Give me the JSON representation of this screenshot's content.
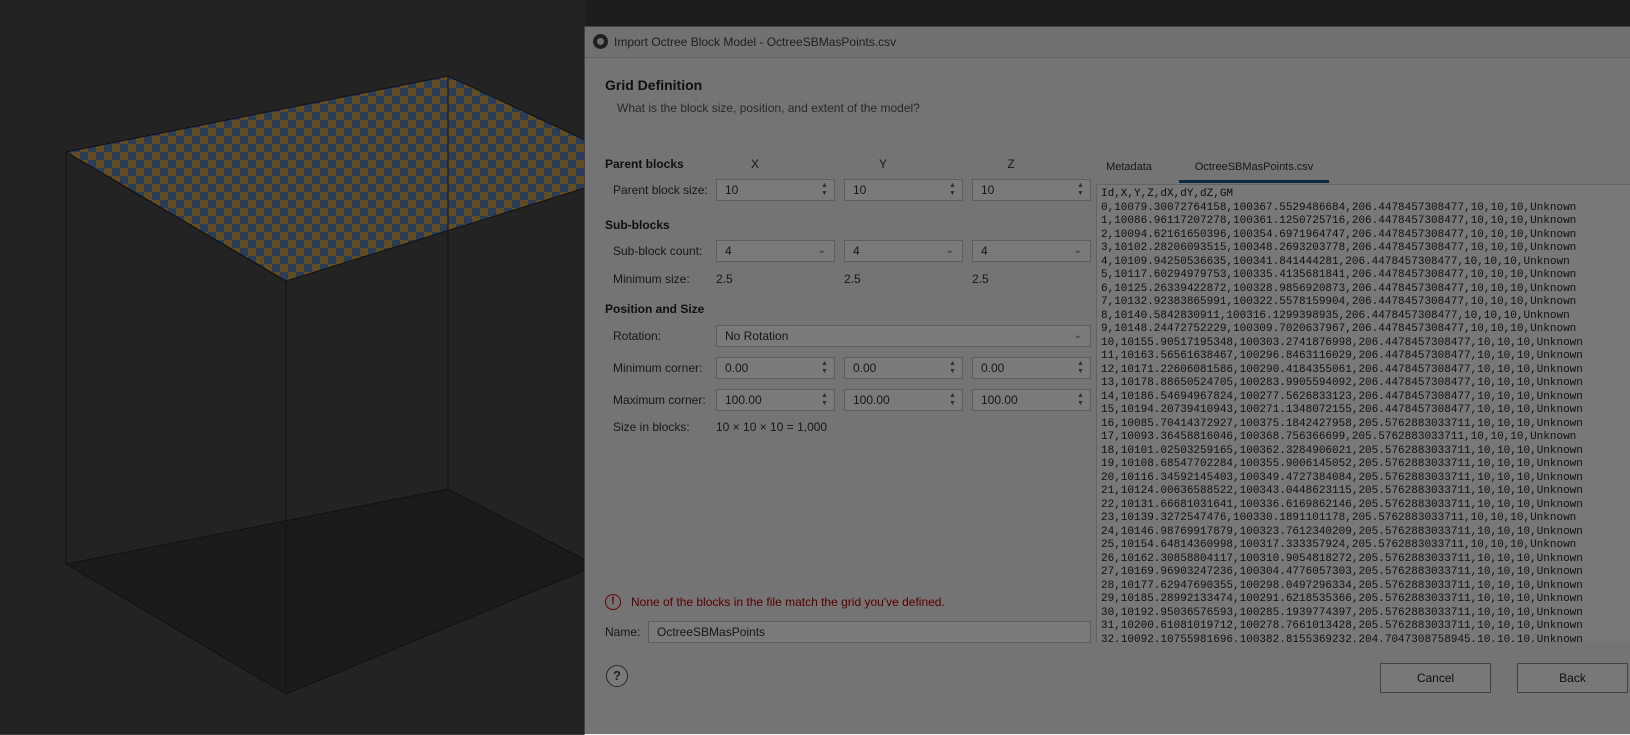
{
  "dialog": {
    "title": "Import Octree Block Model - OctreeSBMasPoints.csv",
    "heading": "Grid Definition",
    "subheading": "What is the block size, position, and extent of the model?"
  },
  "columns": {
    "x": "X",
    "y": "Y",
    "z": "Z"
  },
  "parent_blocks": {
    "section": "Parent blocks",
    "size_label": "Parent block size:",
    "x": "10",
    "y": "10",
    "z": "10"
  },
  "sub_blocks": {
    "section": "Sub-blocks",
    "count_label": "Sub-block count:",
    "x": "4",
    "y": "4",
    "z": "4",
    "min_label": "Minimum size:",
    "min_x": "2.5",
    "min_y": "2.5",
    "min_z": "2.5"
  },
  "position": {
    "section": "Position and Size",
    "rotation_label": "Rotation:",
    "rotation_value": "No Rotation",
    "min_corner_label": "Minimum corner:",
    "min_x": "0.00",
    "min_y": "0.00",
    "min_z": "0.00",
    "max_corner_label": "Maximum corner:",
    "max_x": "100.00",
    "max_y": "100.00",
    "max_z": "100.00",
    "size_blocks_label": "Size in blocks:",
    "size_blocks_value": "10 × 10 × 10 = 1,000"
  },
  "tabs": [
    {
      "label": "Metadata",
      "active": false
    },
    {
      "label": "OctreeSBMasPoints.csv",
      "active": true
    }
  ],
  "csv_lines": [
    "Id,X,Y,Z,dX,dY,dZ,GM",
    "0,10079.30072764158,100367.5529486684,206.4478457308477,10,10,10,Unknown",
    "1,10086.96117207278,100361.1250725716,206.4478457308477,10,10,10,Unknown",
    "2,10094.62161650396,100354.6971964747,206.4478457308477,10,10,10,Unknown",
    "3,10102.28206093515,100348.2693203778,206.4478457308477,10,10,10,Unknown",
    "4,10109.94250536635,100341.841444281,206.4478457308477,10,10,10,Unknown",
    "5,10117.60294979753,100335.4135681841,206.4478457308477,10,10,10,Unknown",
    "6,10125.26339422872,100328.9856920873,206.4478457308477,10,10,10,Unknown",
    "7,10132.92383865991,100322.5578159904,206.4478457308477,10,10,10,Unknown",
    "8,10140.5842830911,100316.1299398935,206.4478457308477,10,10,10,Unknown",
    "9,10148.24472752229,100309.7020637967,206.4478457308477,10,10,10,Unknown",
    "10,10155.90517195348,100303.2741876998,206.4478457308477,10,10,10,Unknown",
    "11,10163.56561638467,100296.8463116029,206.4478457308477,10,10,10,Unknown",
    "12,10171.22606081586,100290.4184355061,206.4478457308477,10,10,10,Unknown",
    "13,10178.88650524705,100283.9905594092,206.4478457308477,10,10,10,Unknown",
    "14,10186.54694967824,100277.5626833123,206.4478457308477,10,10,10,Unknown",
    "15,10194.20739410943,100271.1348072155,206.4478457308477,10,10,10,Unknown",
    "16,10085.70414372927,100375.1842427958,205.5762883033711,10,10,10,Unknown",
    "17,10093.36458816046,100368.756366699,205.5762883033711,10,10,10,Unknown",
    "18,10101.02503259165,100362.3284906021,205.5762883033711,10,10,10,Unknown",
    "19,10108.68547702284,100355.9006145052,205.5762883033711,10,10,10,Unknown",
    "20,10116.34592145403,100349.4727384084,205.5762883033711,10,10,10,Unknown",
    "21,10124.00636588522,100343.0448623115,205.5762883033711,10,10,10,Unknown",
    "22,10131.66681031641,100336.6169862146,205.5762883033711,10,10,10,Unknown",
    "23,10139.3272547476,100330.1891101178,205.5762883033711,10,10,10,Unknown",
    "24,10146.98769917879,100323.7612340209,205.5762883033711,10,10,10,Unknown",
    "25,10154.64814360998,100317.333357924,205.5762883033711,10,10,10,Unknown",
    "26,10162.30858804117,100310.9054818272,205.5762883033711,10,10,10,Unknown",
    "27,10169.96903247236,100304.4776057303,205.5762883033711,10,10,10,Unknown",
    "28,10177.62947690355,100298.0497296334,205.5762883033711,10,10,10,Unknown",
    "29,10185.28992133474,100291.6218535366,205.5762883033711,10,10,10,Unknown",
    "30,10192.95036576593,100285.1939774397,205.5762883033711,10,10,10,Unknown",
    "31,10200.61081019712,100278.7661013428,205.5762883033711,10,10,10,Unknown",
    "32,10092.10755981696,100382.8155369232,204.7047308758945,10,10,10,Unknown"
  ],
  "warning": {
    "icon": "error-circle-icon",
    "text": "None of the blocks in the file match the grid you've defined."
  },
  "name": {
    "label": "Name:",
    "value": "OctreeSBMasPoints"
  },
  "buttons": {
    "help": "?",
    "cancel": "Cancel",
    "back": "Back"
  },
  "colors": {
    "accent_tab": "#1a5a99",
    "warning": "#b00000",
    "grid_blue": "#5b7fb3",
    "grid_orange": "#c9a24a"
  }
}
